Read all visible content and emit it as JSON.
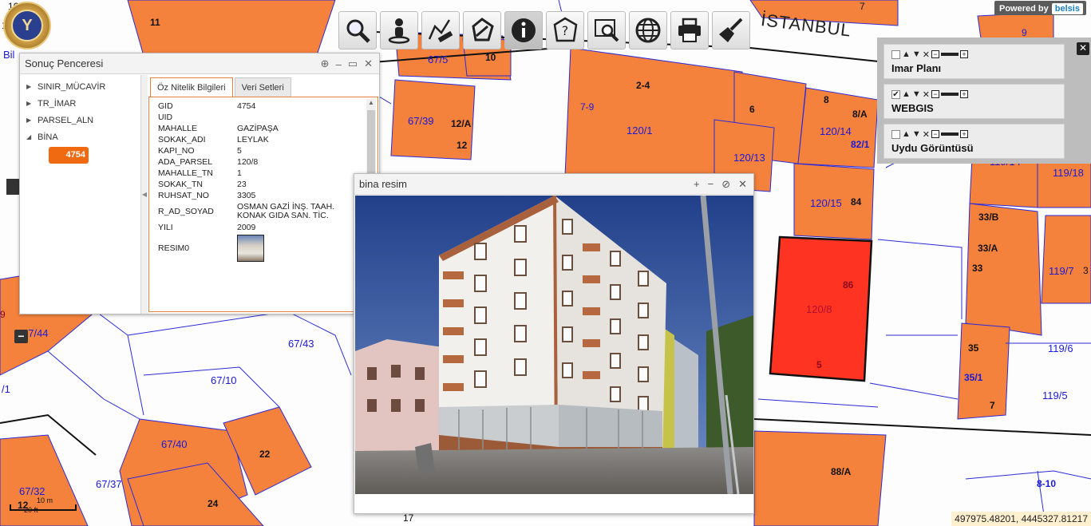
{
  "map": {
    "street_name": "İSTANBUL",
    "partial_label": "Bil",
    "logo_glyph": "Y",
    "powered_by": "Powered by",
    "powered_brand": "belsis",
    "coordinates": "497975.48201, 4445327.81217",
    "scale": {
      "top": "10 m",
      "bottom": "20 ft"
    },
    "zoom": {
      "minus": "−"
    },
    "colors": {
      "parcel": "#f5823c",
      "selected": "#ff3322",
      "line_blue": "#2b2bd8",
      "line_black": "#111111"
    },
    "labels": {
      "p1": "11",
      "p2": "67/5",
      "p3": "10",
      "p4": "2-4",
      "p5": "7-9",
      "p6": "120/1",
      "p7": "6",
      "p8": "8",
      "p9": "8/A",
      "p10": "120/14",
      "p11": "82/1",
      "p12": "120/13",
      "p13": "67/39",
      "p14": "12/A",
      "p15": "12",
      "p16": "120/15",
      "p17": "84",
      "p18": "86",
      "p19": "120/8",
      "p20": "5",
      "p21": "9",
      "p22": "119/14",
      "p23": "119/18",
      "p24": "33/B",
      "p25": "33/A",
      "p26": "33",
      "p27": "119/7",
      "p28": "35",
      "p29": "119/6",
      "p30": "35/1",
      "p31": "119/5",
      "p32": "7",
      "p33": "88/A",
      "p34": "8-10",
      "p35": "67/44",
      "p36": "67/43",
      "p37": "67/10",
      "p38": "67/40",
      "p39": "22",
      "p40": "67/32",
      "p41": "67/37",
      "p42": "24",
      "p43": "12",
      "p44": "17",
      "p45": "12",
      "p46": "/1",
      "p47": "9",
      "p48": "7",
      "p49": "16",
      "p50": "11",
      "p51": "3"
    }
  },
  "toolbar": {
    "tools": [
      {
        "name": "search-tool",
        "icon": "magnifier-icon"
      },
      {
        "name": "street-view-tool",
        "icon": "person-pin-icon"
      },
      {
        "name": "measure-tool",
        "icon": "ruler-icon"
      },
      {
        "name": "area-tool",
        "icon": "polygon-icon"
      },
      {
        "name": "info-tool",
        "icon": "info-icon",
        "active": true
      },
      {
        "name": "query-tool",
        "icon": "question-polygon-icon"
      },
      {
        "name": "zoom-box-tool",
        "icon": "zoom-rect-icon"
      },
      {
        "name": "globe-tool",
        "icon": "globe-icon"
      },
      {
        "name": "print-tool",
        "icon": "printer-icon"
      },
      {
        "name": "clear-tool",
        "icon": "broom-icon"
      }
    ]
  },
  "layers": [
    {
      "name": "Imar Planı",
      "checked": false
    },
    {
      "name": "WEBGIS",
      "checked": true
    },
    {
      "name": "Uydu Görüntüsü",
      "checked": false
    }
  ],
  "layers_ctrl": {
    "check": "✔",
    "up": "▲",
    "down": "▼",
    "remove": "✕",
    "minus": "−",
    "plus": "+",
    "close": "✕"
  },
  "result_window": {
    "title": "Sonuç Penceresi",
    "controls": {
      "globe": "⊕",
      "minimize": "–",
      "maximize": "▭",
      "close": "✕"
    },
    "tree": {
      "items": [
        {
          "label": "SINIR_MÜCAVİR",
          "arrow": "▶"
        },
        {
          "label": "TR_İMAR",
          "arrow": "▶"
        },
        {
          "label": "PARSEL_ALN",
          "arrow": "▶"
        },
        {
          "label": "BİNA",
          "arrow": "◢"
        }
      ],
      "badge": "4754"
    },
    "splitter": "◀",
    "tabs": [
      "Öz Nitelik Bilgileri",
      "Veri Setleri"
    ],
    "properties": [
      {
        "key": "GID",
        "value": "4754"
      },
      {
        "key": "UID",
        "value": ""
      },
      {
        "key": "MAHALLE",
        "value": "GAZİPAŞA"
      },
      {
        "key": "SOKAK_ADI",
        "value": "LEYLAK"
      },
      {
        "key": "KAPI_NO",
        "value": "5"
      },
      {
        "key": "ADA_PARSEL",
        "value": "120/8"
      },
      {
        "key": "MAHALLE_TN",
        "value": "1"
      },
      {
        "key": "SOKAK_TN",
        "value": "23"
      },
      {
        "key": "RUHSAT_NO",
        "value": "3305"
      },
      {
        "key": "R_AD_SOYAD",
        "value": "OSMAN GAZİ İNŞ. TAAH. KONAK GIDA SAN. TİC."
      },
      {
        "key": "YILI",
        "value": "2009"
      }
    ],
    "image_key": "RESIM0",
    "scroll_up": "▲"
  },
  "photo_window": {
    "title": "bina resim",
    "controls": {
      "zoom_in": "+",
      "zoom_out": "−",
      "reset": "⊘",
      "close": "✕"
    }
  }
}
